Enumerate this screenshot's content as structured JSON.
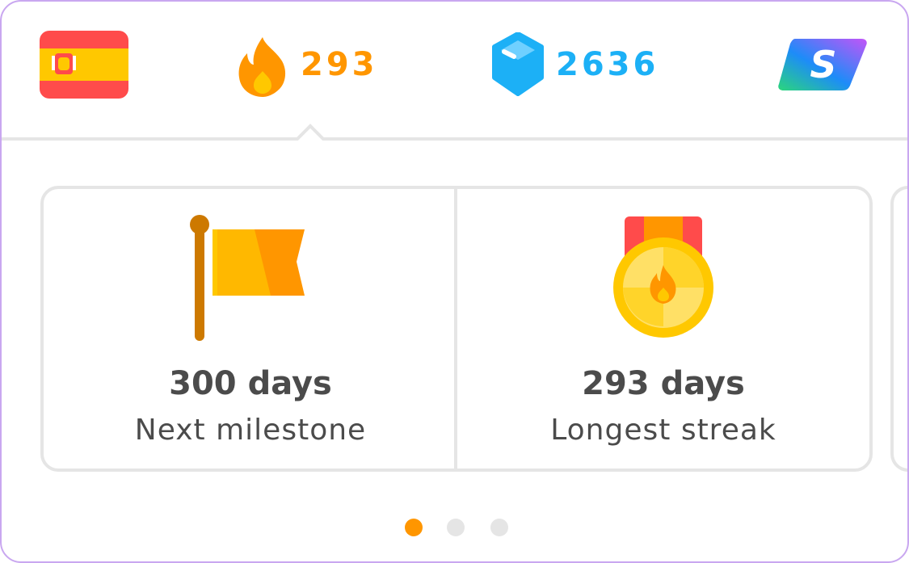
{
  "header": {
    "language": {
      "icon": "spain-flag-icon"
    },
    "streak": {
      "icon": "fire-icon",
      "value": "293",
      "color": "#ff9600"
    },
    "gems": {
      "icon": "gem-icon",
      "value": "2636",
      "color": "#1cb0f6"
    },
    "super": {
      "icon": "super-duolingo-icon"
    }
  },
  "cards": [
    {
      "icon": "milestone-flag-icon",
      "value": "300 days",
      "label": "Next milestone"
    },
    {
      "icon": "streak-medal-icon",
      "value": "293 days",
      "label": "Longest streak"
    }
  ],
  "pagination": {
    "count": 3,
    "active_index": 0,
    "active_color": "#ff9600",
    "inactive_color": "#e5e5e5"
  }
}
